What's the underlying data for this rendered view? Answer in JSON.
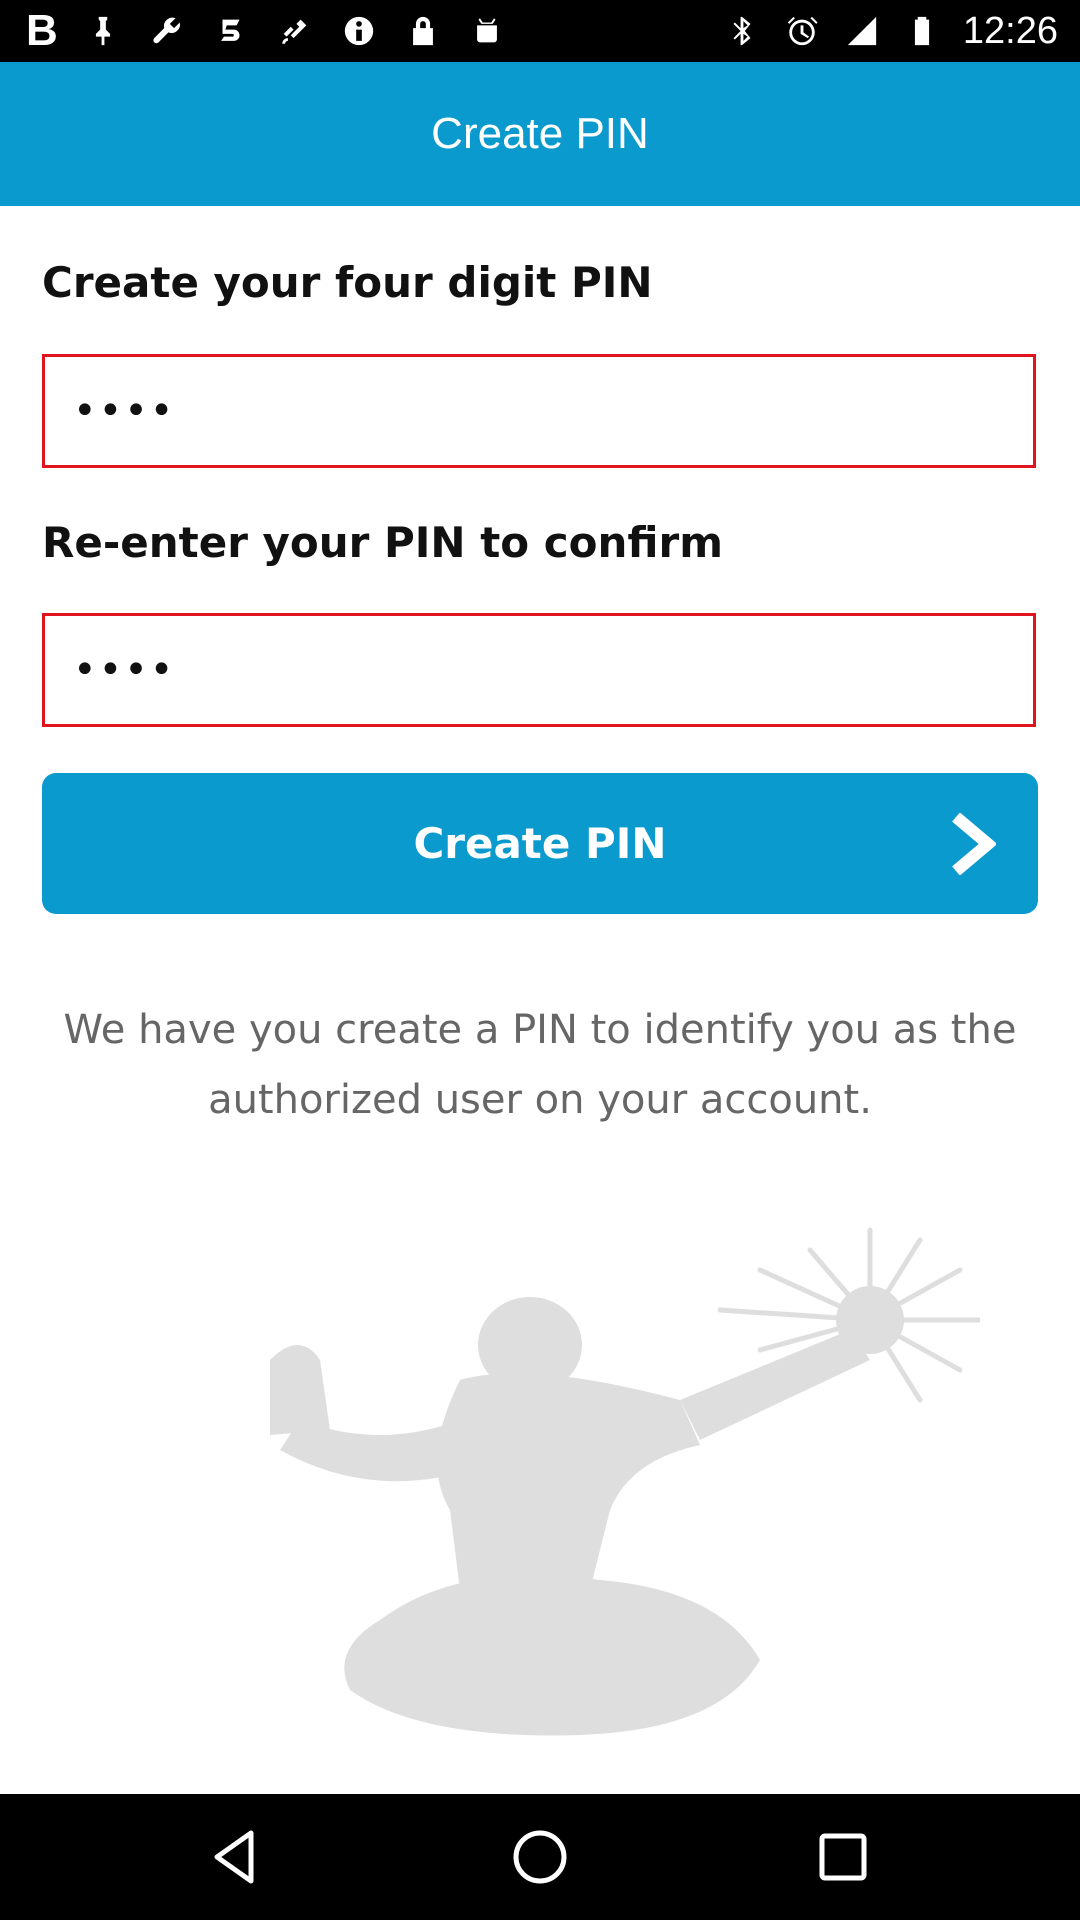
{
  "status_bar": {
    "left_icons": [
      "brand-b-icon",
      "pin-icon",
      "wrench-icon",
      "sprint-icon",
      "fake-gps-icon",
      "info-icon",
      "lock-icon",
      "android-icon"
    ],
    "brand_letter": "B",
    "right_icons": [
      "bluetooth-icon",
      "alarm-icon",
      "signal-icon",
      "battery-icon"
    ],
    "time": "12:26"
  },
  "app_bar": {
    "title": "Create PIN",
    "color": "#0a9ace"
  },
  "form": {
    "pin_label": "Create your four digit PIN",
    "pin_value": "••••",
    "confirm_label": "Re-enter your PIN to confirm",
    "confirm_value": "••••",
    "field_border_color": "#e0141e",
    "submit_label": "Create PIN",
    "submit_icon": "chevron-right-icon"
  },
  "info_text": "We have you create a PIN to identify you as the authorized user on your account.",
  "watermark": "spirit-statue-watermark",
  "nav_bar": {
    "buttons": [
      "back-icon",
      "home-icon",
      "recents-icon"
    ]
  }
}
